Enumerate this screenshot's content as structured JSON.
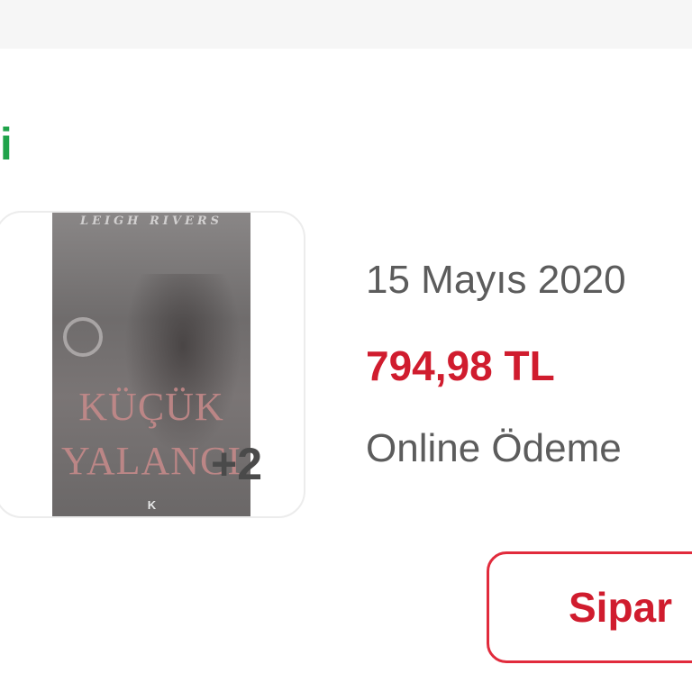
{
  "order": {
    "status": "li",
    "date": "15 Mayıs 2020",
    "total": "794,98 TL",
    "payment": "Online Ödeme",
    "extra_items": "+2",
    "details_button": "Sipar"
  },
  "book_cover": {
    "author": "LEIGH RIVERS",
    "title_line1": "KÜÇÜK",
    "title_line2": "YALANCI",
    "publisher_logo": "K"
  },
  "colors": {
    "status_green": "#1fa34a",
    "price_red": "#d01c2e",
    "button_border": "#e12b3c",
    "muted_text": "#5c5c5c"
  }
}
